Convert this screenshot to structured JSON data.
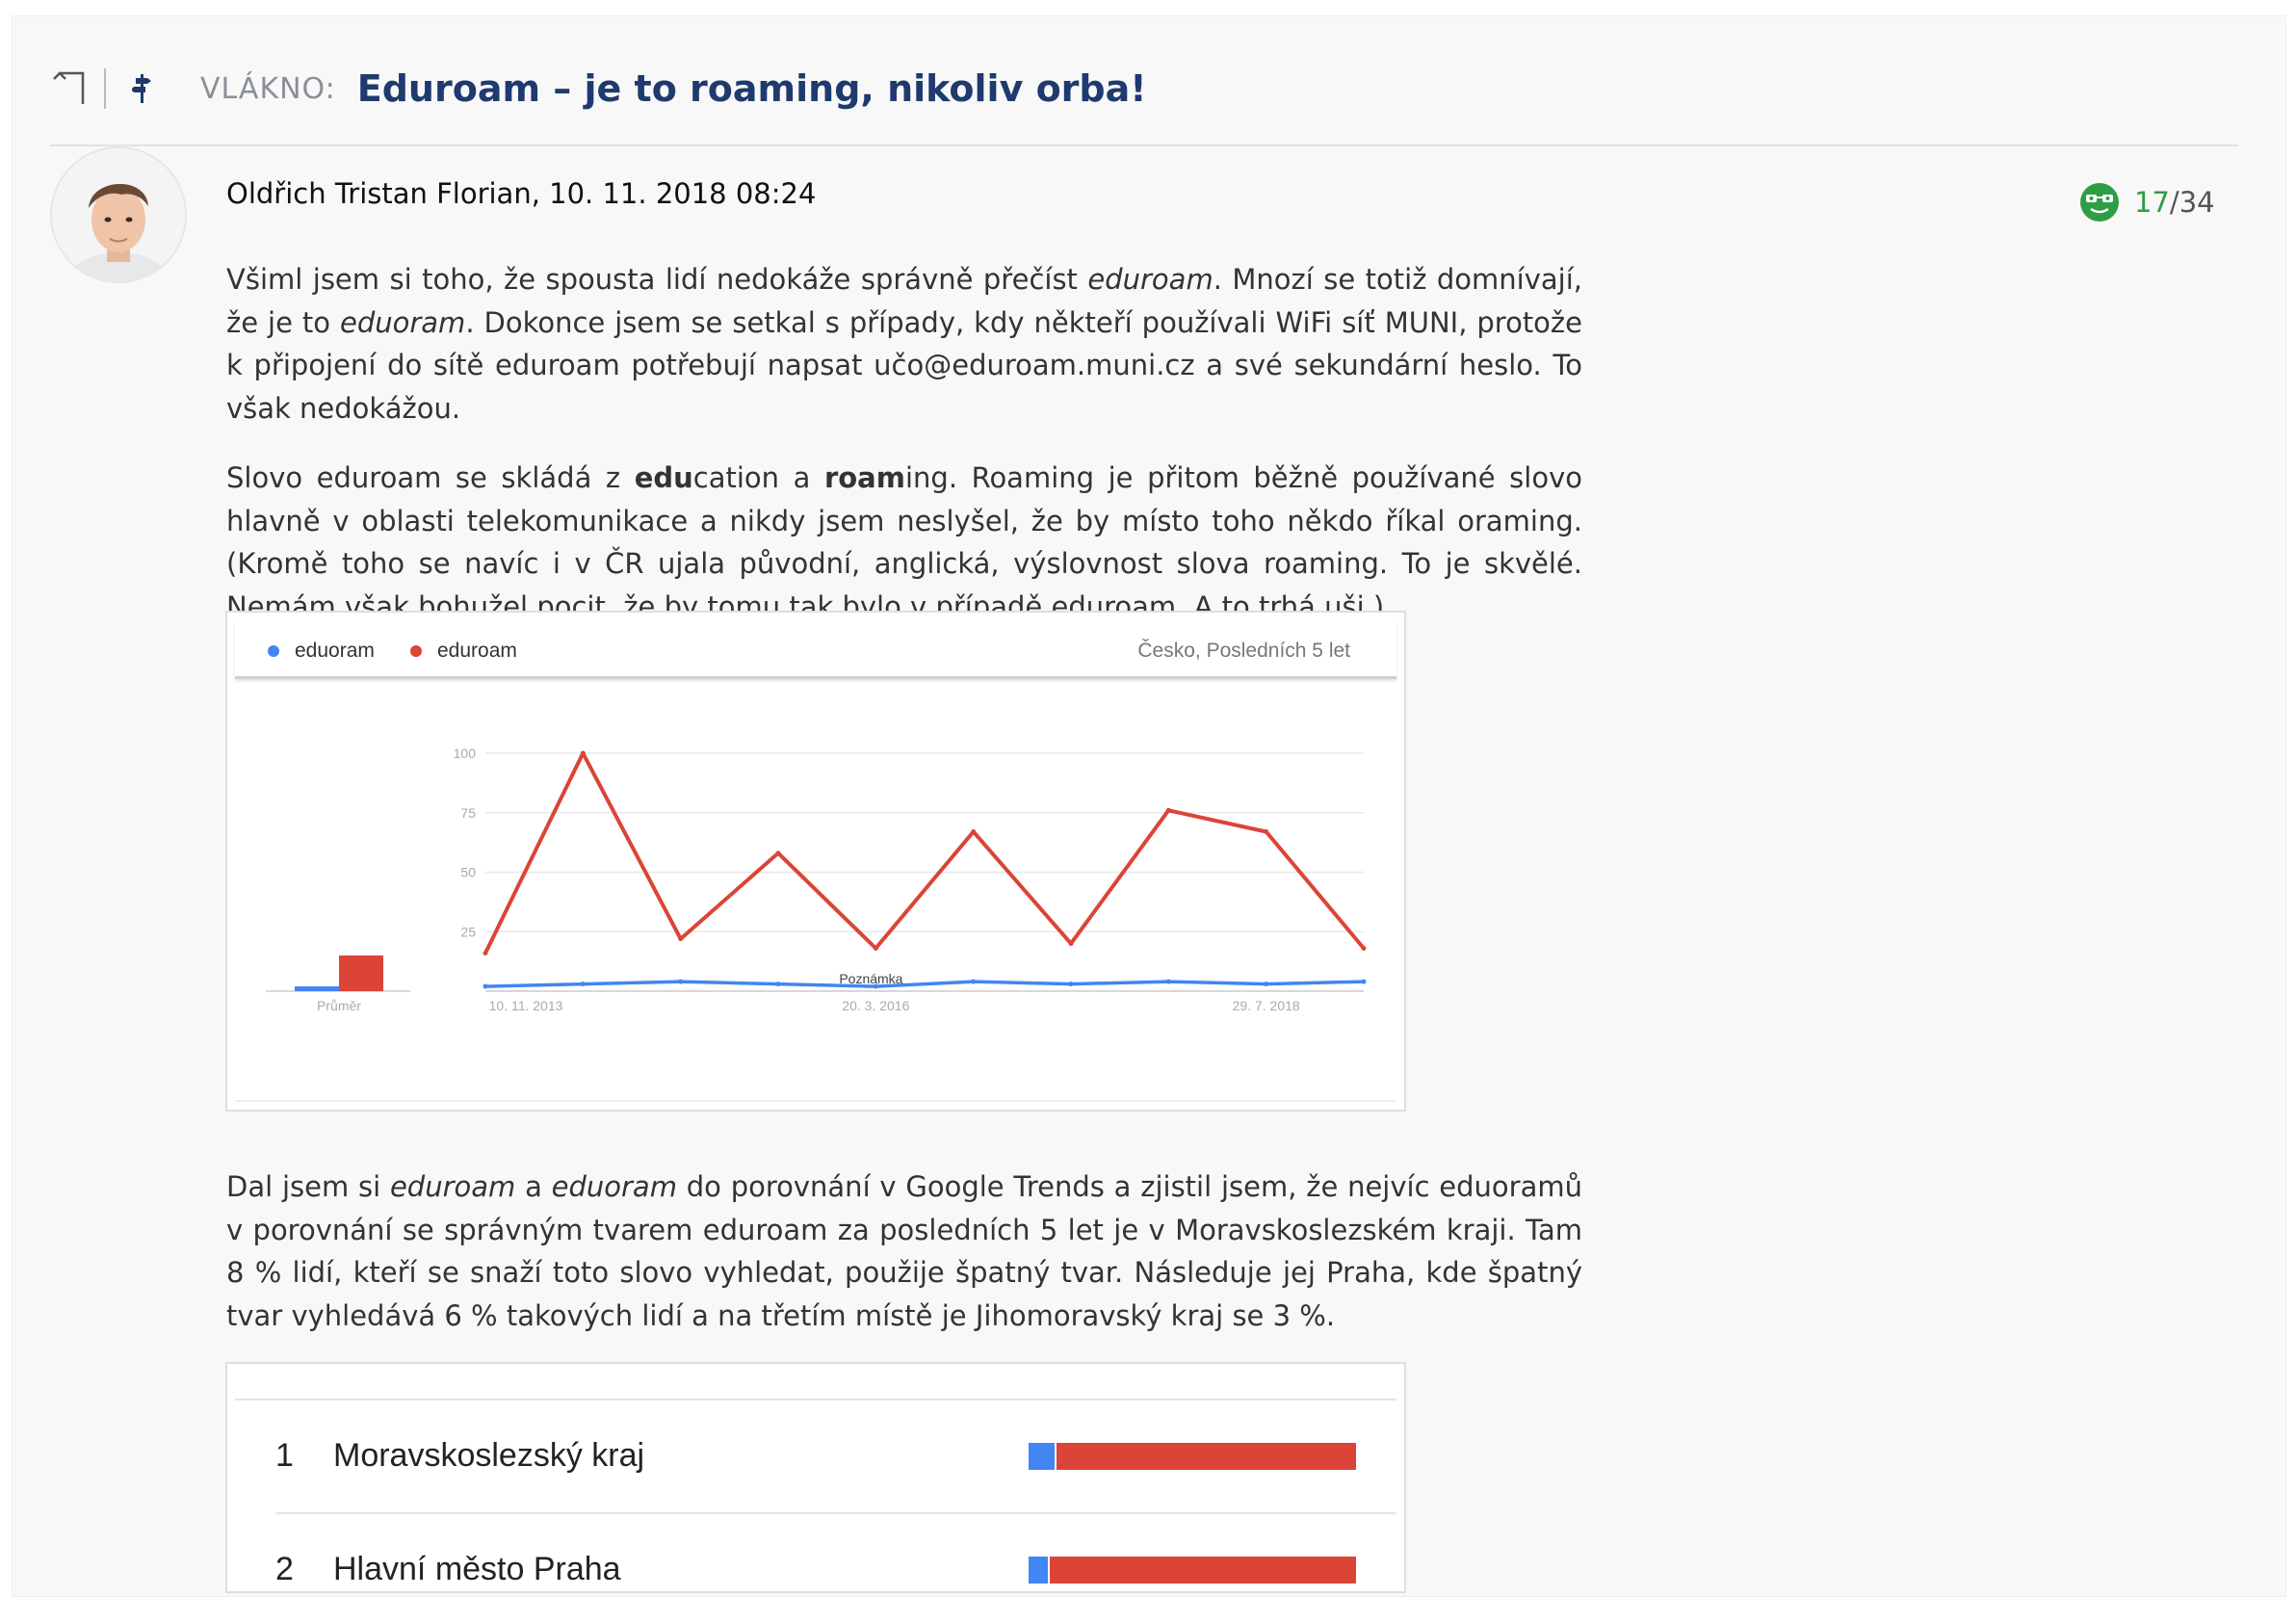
{
  "header": {
    "label": "VLÁKNO:",
    "title": "Eduroam – je to roaming, nikoliv orba!"
  },
  "post": {
    "author_line": "Oldřich Tristan Florian, 10. 11. 2018 08:24",
    "rating": {
      "positive": "17",
      "separator": "/",
      "total": "34"
    },
    "p1": {
      "a": "Všiml jsem si toho, že spousta lidí nedokáže správně přečíst ",
      "b": "eduroam",
      "c": ". Mnozí se totiž domnívají, že je to ",
      "d": "eduoram",
      "e": ". Dokonce jsem se setkal s případy, kdy někteří používali WiFi síť MUNI, protože k připojení do sítě eduroam potřebují napsat učo@eduroam.muni.cz a své sekundární heslo. To však nedokážou."
    },
    "p2": {
      "a": "Slovo eduroam se skládá z ",
      "b": "edu",
      "c": "cation a ",
      "d": "roam",
      "e": "ing. Roaming je přitom běžně používané slovo hlavně v oblasti telekomunikace a nikdy jsem neslyšel, že by místo toho někdo říkal oraming. (Kromě toho se navíc i v ČR ujala původní, anglická, výslovnost slova roaming. To je skvělé. Nemám však bohužel pocit, že by tomu tak bylo v případě eduroam. A to trhá uši.)"
    },
    "p3": {
      "a": "Dal jsem si ",
      "b": "eduroam",
      "c": " a ",
      "d": "eduoram",
      "e": " do porovnání v Google Trends a zjistil jsem, že nejvíc eduoramů v porovnání se správným tvarem eduroam za posledních 5 let je v Moravskoslezském kraji. Tam 8 % lidí, kteří se snaží toto slovo vyhledat, použije špatný tvar. Následuje jej Praha, kde špatný tvar vyhledává 6 % takových lidí a na třetím místě je Jihomoravský kraj se 3 %."
    }
  },
  "chart_data": {
    "type": "line",
    "legend": [
      "eduoram",
      "eduroam"
    ],
    "region_label": "Česko, Posledních 5 let",
    "yticks": [
      25,
      50,
      75,
      100
    ],
    "ylim": [
      0,
      100
    ],
    "xticks": [
      "10. 11. 2013",
      "20. 3. 2016",
      "29. 7. 2018"
    ],
    "x": [
      "2013-11-10",
      "2014-06",
      "2015-01",
      "2015-09",
      "2016-03-20",
      "2016-10",
      "2017-05",
      "2017-12",
      "2018-07-29",
      "2018-11"
    ],
    "series": [
      {
        "name": "eduoram",
        "color": "#4285f4",
        "values": [
          2,
          3,
          4,
          3,
          2,
          4,
          3,
          4,
          3,
          4
        ]
      },
      {
        "name": "eduroam",
        "color": "#db4437",
        "values": [
          16,
          100,
          22,
          58,
          18,
          67,
          20,
          76,
          67,
          18
        ]
      }
    ],
    "average_label": "Průměr",
    "average": {
      "eduoram": 2,
      "eduroam": 15
    },
    "annotation": "Poznámka"
  },
  "regions": {
    "rows": [
      {
        "rank": "1",
        "name": "Moravskoslezský kraj",
        "eduoram_pct": 8
      },
      {
        "rank": "2",
        "name": "Hlavní město Praha",
        "eduoram_pct": 6
      }
    ],
    "colors": {
      "eduoram": "#4285f4",
      "eduroam": "#db4437"
    }
  }
}
